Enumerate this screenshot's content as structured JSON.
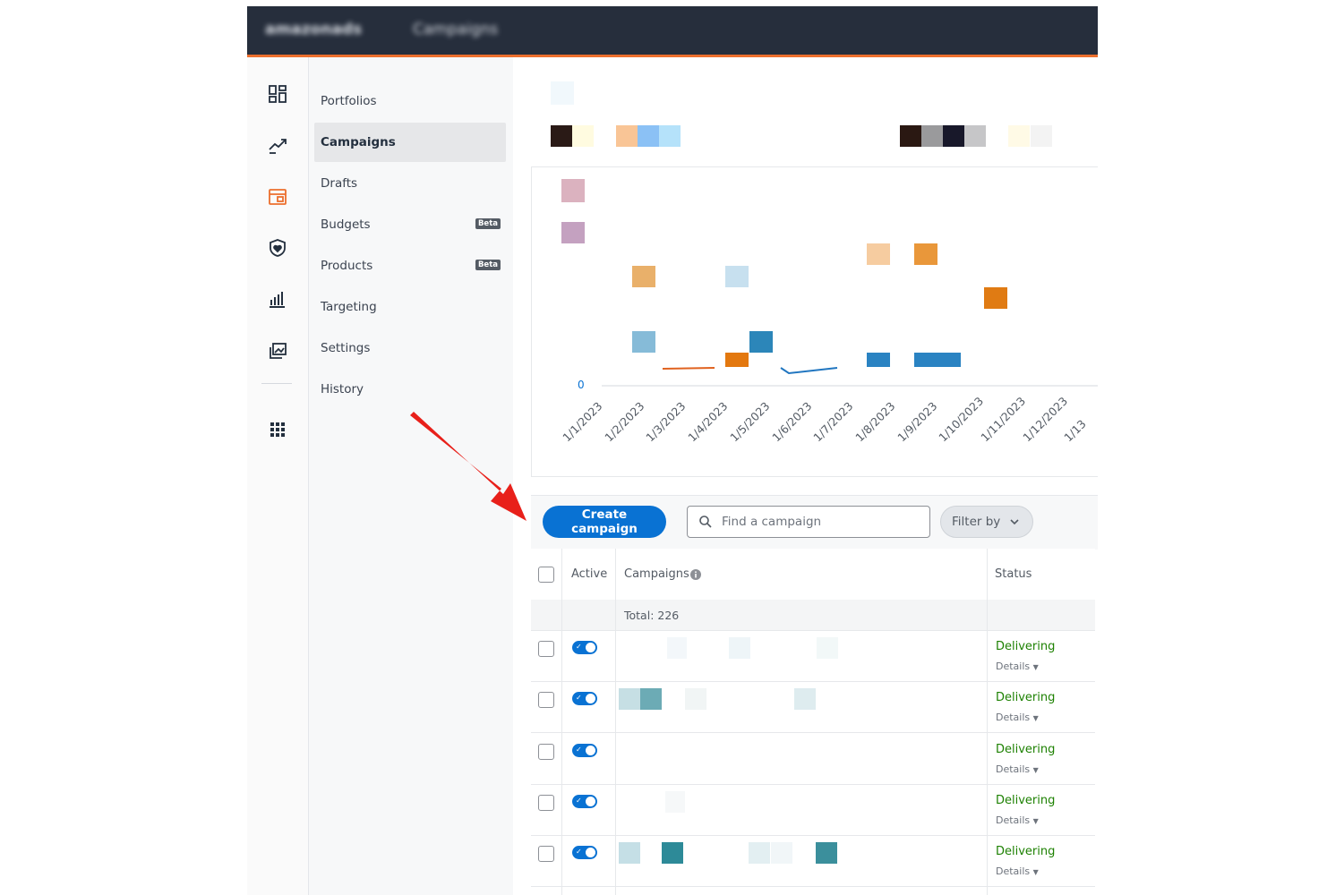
{
  "topbar": {
    "logo_text": "amazonads",
    "breadcrumb": "Campaigns"
  },
  "rail_icons": [
    {
      "name": "overview-icon"
    },
    {
      "name": "trending-icon"
    },
    {
      "name": "campaign-manager-icon"
    },
    {
      "name": "brand-protection-icon"
    },
    {
      "name": "measurement-icon"
    },
    {
      "name": "creative-library-icon"
    },
    {
      "name": "apps-grid-icon"
    }
  ],
  "nav": {
    "items": [
      {
        "label": "Portfolios"
      },
      {
        "label": "Campaigns"
      },
      {
        "label": "Drafts"
      },
      {
        "label": "Budgets",
        "badge": "Beta"
      },
      {
        "label": "Products",
        "badge": "Beta"
      },
      {
        "label": "Targeting"
      },
      {
        "label": "Settings"
      },
      {
        "label": "History"
      }
    ]
  },
  "chart": {
    "zero_label": "0",
    "x_labels": [
      "1/1/2023",
      "1/2/2023",
      "1/3/2023",
      "1/4/2023",
      "1/5/2023",
      "1/6/2023",
      "1/7/2023",
      "1/8/2023",
      "1/9/2023",
      "1/10/2023",
      "1/11/2023",
      "1/12/2023",
      "1/13"
    ]
  },
  "toolbar": {
    "create_label": "Create campaign",
    "search_placeholder": "Find a campaign",
    "filter_label": "Filter by"
  },
  "table": {
    "col_active": "Active",
    "col_campaigns": "Campaigns",
    "col_status": "Status",
    "total": "Total: 226",
    "rows": [
      {
        "status": "Delivering",
        "details": "Details"
      },
      {
        "status": "Delivering",
        "details": "Details"
      },
      {
        "status": "Delivering",
        "details": "Details"
      },
      {
        "status": "Delivering",
        "details": "Details"
      },
      {
        "status": "Delivering",
        "details": "Details"
      }
    ]
  },
  "colors": {
    "primary": "#0972d3",
    "topbar": "#262e3c",
    "accent_orange": "#ec6f2d",
    "status_green": "#1d8102",
    "arrow_red": "#e8201a"
  }
}
